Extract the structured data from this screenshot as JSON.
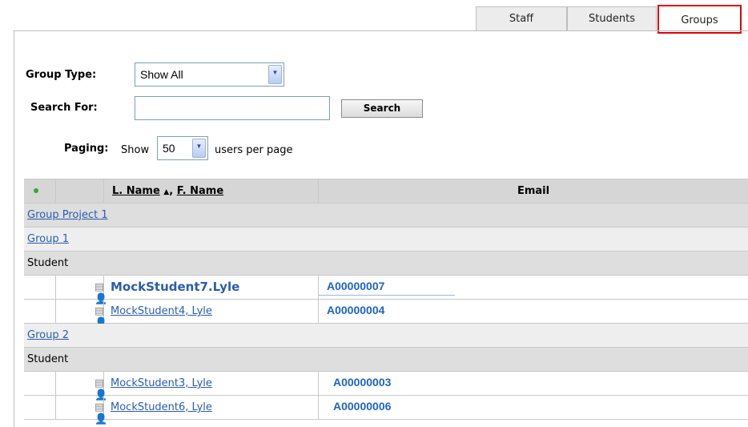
{
  "tabs": [
    {
      "label": "Staff",
      "active": false
    },
    {
      "label": "Students",
      "active": false
    },
    {
      "label": "Groups",
      "active": true
    }
  ],
  "filters": {
    "group_type_label": "Group Type:",
    "group_type_value": "Show All",
    "search_label": "Search For:",
    "search_value": "",
    "search_button": "Search",
    "paging_label": "Paging:",
    "paging_show": "Show",
    "paging_value": "50",
    "paging_suffix": "users per page"
  },
  "table": {
    "header": {
      "lname": "L. Name",
      "sort_indicator": "▲",
      "sep": ",",
      "fname": "F. Name",
      "email": "Email"
    },
    "project": "Group Project 1",
    "groups": [
      {
        "name": "Group 1",
        "role": "Student",
        "members": [
          {
            "name": "MockStudent7.Lyle",
            "email": "A00000007"
          },
          {
            "name": "MockStudent4, Lyle",
            "email": "A00000004"
          }
        ]
      },
      {
        "name": "Group 2",
        "role": "Student",
        "members": [
          {
            "name": "MockStudent3, Lyle",
            "email": "A00000003"
          },
          {
            "name": "MockStudent6, Lyle",
            "email": "A00000006"
          }
        ]
      }
    ]
  },
  "icons": {
    "edit": "edit-note-icon",
    "user": "user-profile-icon",
    "dropdown": "chevron-down-icon",
    "status": "status-dot-icon"
  },
  "colors": {
    "active_tab_border": "#e00000",
    "link": "#2a5db0",
    "email": "#1f63c6",
    "status_dot": "#3ba33b"
  }
}
